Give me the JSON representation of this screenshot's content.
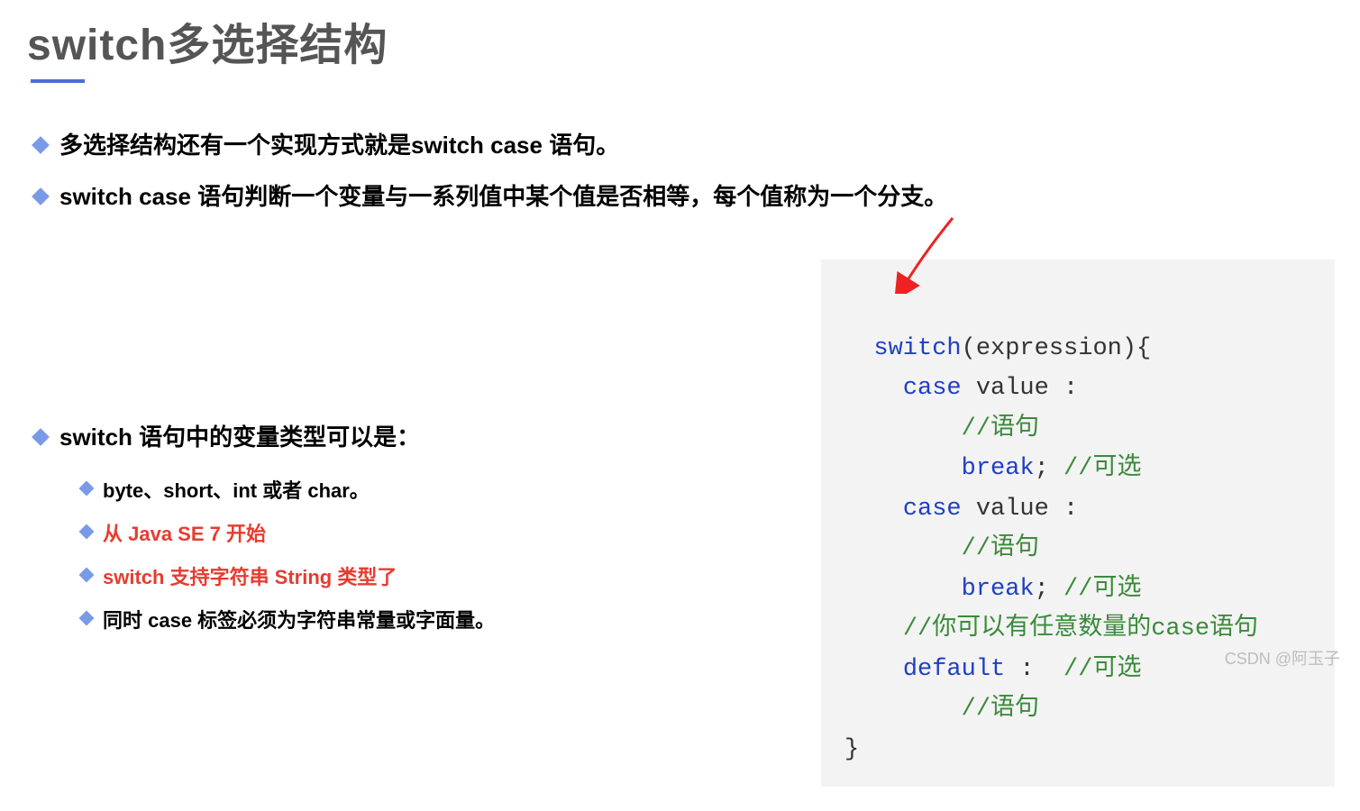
{
  "title": "switch多选择结构",
  "bullets": {
    "b1": "多选择结构还有一个实现方式就是switch case 语句。",
    "b2": "switch case 语句判断一个变量与一系列值中某个值是否相等，每个值称为一个分支。",
    "b3": "switch 语句中的变量类型可以是："
  },
  "subs": {
    "s1": "byte、short、int 或者 char。",
    "s2": "从 Java SE 7 开始",
    "s3": "switch 支持字符串 String 类型了",
    "s4": "同时 case 标签必须为字符串常量或字面量。"
  },
  "code": {
    "kw_switch": "switch",
    "l1_tail": "(expression){",
    "kw_case": "case",
    "case_tail": " value :",
    "cm_stmt": "//语句",
    "kw_break": "break",
    "semi": ";",
    "cm_opt": " //可选",
    "cm_many": "//你可以有任意数量的case语句",
    "kw_default": "default",
    "default_tail": " : ",
    "brace_close": "}"
  },
  "watermark": "CSDN @阿玉子"
}
